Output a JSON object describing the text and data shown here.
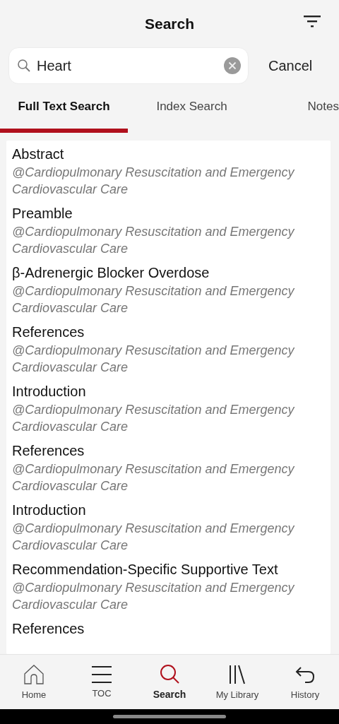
{
  "header": {
    "title": "Search"
  },
  "search": {
    "value": "Heart",
    "cancel": "Cancel"
  },
  "tabs": [
    {
      "label": "Full Text Search",
      "selected": true
    },
    {
      "label": "Index Search",
      "selected": false
    },
    {
      "label": "Notes",
      "selected": false
    }
  ],
  "results": [
    {
      "title": "Abstract",
      "source": "@Cardiopulmonary Resuscitation and Emergency Cardiovascular Care"
    },
    {
      "title": "Preamble",
      "source": "@Cardiopulmonary Resuscitation and Emergency Cardiovascular Care"
    },
    {
      "title": "β-Adrenergic Blocker Overdose",
      "source": "@Cardiopulmonary Resuscitation and Emergency Cardiovascular Care"
    },
    {
      "title": "References",
      "source": "@Cardiopulmonary Resuscitation and Emergency Cardiovascular Care"
    },
    {
      "title": "Introduction",
      "source": "@Cardiopulmonary Resuscitation and Emergency Cardiovascular Care"
    },
    {
      "title": "References",
      "source": "@Cardiopulmonary Resuscitation and Emergency Cardiovascular Care"
    },
    {
      "title": "Introduction",
      "source": "@Cardiopulmonary Resuscitation and Emergency Cardiovascular Care"
    },
    {
      "title": "Recommendation-Specific Supportive Text",
      "source": "@Cardiopulmonary Resuscitation and Emergency Cardiovascular Care"
    },
    {
      "title": "References"
    }
  ],
  "nav": [
    {
      "kind": "home",
      "label": "Home",
      "selected": false
    },
    {
      "kind": "toc",
      "label": "TOC",
      "selected": false
    },
    {
      "kind": "search",
      "label": "Search",
      "selected": true
    },
    {
      "kind": "library",
      "label": "My Library",
      "selected": false
    },
    {
      "kind": "history",
      "label": "History",
      "selected": false
    }
  ]
}
